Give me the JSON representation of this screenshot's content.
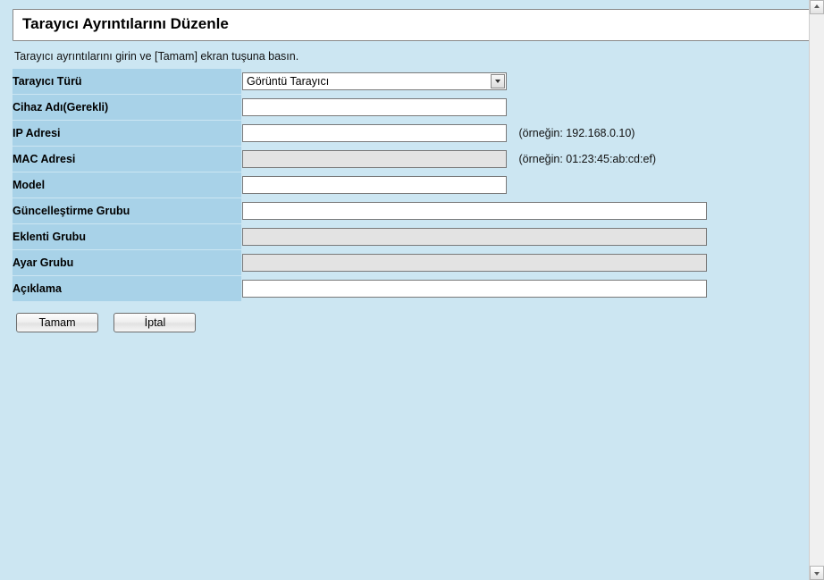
{
  "title": "Tarayıcı Ayrıntılarını Düzenle",
  "instructions": "Tarayıcı ayrıntılarını girin ve [Tamam] ekran tuşuna basın.",
  "fields": {
    "scanner_type": {
      "label": "Tarayıcı Türü",
      "value": "Görüntü Tarayıcı"
    },
    "device_name": {
      "label": "Cihaz Adı(Gerekli)",
      "value": ""
    },
    "ip_address": {
      "label": "IP Adresi",
      "value": "",
      "hint": "(örneğin: 192.168.0.10)"
    },
    "mac_address": {
      "label": "MAC Adresi",
      "value": "",
      "hint": "(örneğin: 01:23:45:ab:cd:ef)"
    },
    "model": {
      "label": "Model",
      "value": ""
    },
    "update_group": {
      "label": "Güncelleştirme Grubu",
      "value": ""
    },
    "addon_group": {
      "label": "Eklenti Grubu",
      "value": ""
    },
    "settings_group": {
      "label": "Ayar Grubu",
      "value": ""
    },
    "description": {
      "label": "Açıklama",
      "value": ""
    }
  },
  "buttons": {
    "ok": "Tamam",
    "cancel": "İptal"
  }
}
